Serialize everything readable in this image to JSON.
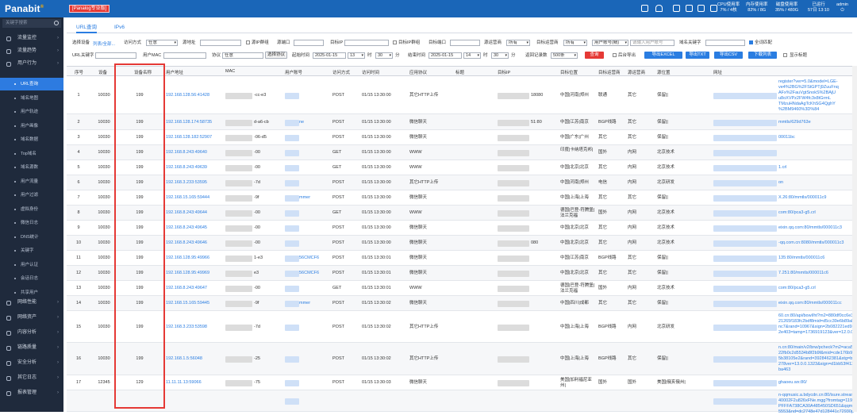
{
  "topbar": {
    "logo_text": "Panabit",
    "logo_mark": "®",
    "edition_badge": "[Panalog专业版]",
    "icons": [
      "grid-icon",
      "bell-icon",
      "download-icon",
      "desktop-icon",
      "print-icon",
      "monitor-icon",
      "layout-icon"
    ],
    "stats": [
      {
        "label": "CPU使用率",
        "value": "7% / 4核"
      },
      {
        "label": "内存使用率",
        "value": "82% / 8G"
      },
      {
        "label": "磁盘使用率",
        "value": "35% / 480G"
      },
      {
        "label": "已运行",
        "value": "57日 13:10"
      },
      {
        "label": "admin",
        "value": "⏻"
      }
    ]
  },
  "sidebar": {
    "search_placeholder": "关键字搜索",
    "groups_top": [
      {
        "label": "流量监控",
        "icon": "gauge-icon"
      },
      {
        "label": "流量趋势",
        "icon": "trend-icon"
      },
      {
        "label": "用户行为",
        "icon": "user-icon"
      }
    ],
    "items": [
      "URL查询",
      "域名地图",
      "用户轨迹",
      "用户画像",
      "域名数据",
      "Top域名",
      "域名源数",
      "用户流量",
      "用户过滤",
      "虚拟身份",
      "微信日志",
      "DNS统计",
      "关键字",
      "用户认证",
      "会话日志",
      "共享用户"
    ],
    "active_item": "URL查询",
    "groups_bottom": [
      {
        "label": "网络性能",
        "icon": "wifi-icon"
      },
      {
        "label": "网络资产",
        "icon": "globe-icon"
      },
      {
        "label": "内容分析",
        "icon": "layers-icon"
      },
      {
        "label": "链路质量",
        "icon": "link-icon"
      },
      {
        "label": "安全分析",
        "icon": "shield-icon"
      },
      {
        "label": "其它日志",
        "icon": "file-icon"
      },
      {
        "label": "报表管理",
        "icon": "report-icon"
      }
    ]
  },
  "tabs": [
    {
      "label": "URL查询",
      "active": true
    },
    {
      "label": "IPv6",
      "active": false
    }
  ],
  "filters": {
    "row1": {
      "select_device_label": "选择设备",
      "device_list_link": "列表/全部...",
      "access_method_label": "访问方式",
      "access_method_value": "任意",
      "src_addr_label": "源地址",
      "exclude_ip_group_label": "源IP群组",
      "src_port_label": "源端口",
      "dst_ip_label": "目标IP",
      "dst_ip_group_label": "目标IP群组",
      "dst_port_label": "目标端口",
      "src_operator_label": "源运营商",
      "src_operator_value": "所有",
      "dst_operator_label": "目标运营商",
      "dst_operator_value": "所有",
      "user_account_select": "用户账号(精)",
      "user_account_placeholder": "请输入用户账号",
      "domain_keyword_label": "域名关键字",
      "exact_match_label": "全词匹配"
    },
    "row2": {
      "url_keyword_label": "URL关键字",
      "user_mac_label": "用户MAC",
      "protocol_label": "协议",
      "protocol_value": "任意",
      "choose_protocol_btn": "选择协议",
      "start_time_label": "起始时间",
      "start_date": "2025-01-15",
      "start_hour": "13",
      "start_hour_unit": "时",
      "start_min": "30",
      "start_min_unit": "分",
      "end_time_label": "结束时间",
      "end_date": "2025-01-15",
      "end_hour": "14",
      "end_hour_unit": "时",
      "end_min": "30",
      "end_min_unit": "分",
      "return_count_label": "返回记录数",
      "return_count_value": "500条",
      "query_btn": "查询",
      "background_export_label": "后台导出",
      "export_excel_btn": "导出EXCEL",
      "export_txt_btn": "导出TXT",
      "export_csv_btn": "导出CSV",
      "download_list_btn": "下载列表",
      "show_title_label": "显示标题"
    }
  },
  "table": {
    "headers": [
      "序号",
      "设备",
      "设备名称",
      "用户地址",
      "MAC",
      "用户账号",
      "访问方式",
      "访问时间",
      "应用协议",
      "标题",
      "目标IP",
      "目标位置",
      "目标运营商",
      "源运营商",
      "源位置",
      "网址"
    ],
    "rows": [
      {
        "seq": "1",
        "dev": "10030",
        "name": "199",
        "addr": "192.168.128.56:41428",
        "mac": "-cc-e3",
        "acct": "",
        "method": "POST",
        "time": "01/15 13:30:00",
        "app": "其它HTTP上传",
        "dst_ip": "18080",
        "dst_loc": "中国|河南|郑州",
        "dst_op": "联通",
        "src_op": "其它",
        "src_loc": "保留||",
        "url": "register?ver=5.0&model=LGE-\nve4%2BG%2FStGPTj9ZuuFnq\nAFx%2FauVgtSnokS%2BAjU\nu8oXVPz2FW4fc3x8tGrmL\nTMzuHNdaAgTcKhSG4QghY\n%2BM9460%3D%84"
      },
      {
        "seq": "2",
        "dev": "10030",
        "name": "199",
        "addr": "192.168.128.174:58735",
        "mac": "d-a6-cb",
        "acct": "ne",
        "method": "POST",
        "time": "01/15 13:30:00",
        "app": "微信聊天",
        "dst_ip": "51:80",
        "dst_loc": "中国|江苏|南京",
        "dst_op": "BGP线路",
        "src_op": "其它",
        "src_loc": "保留||",
        "url": "mmtls/629d763e"
      },
      {
        "seq": "3",
        "dev": "10030",
        "name": "199",
        "addr": "192.168.128.182:52907",
        "mac": "-06-d5",
        "acct": "",
        "method": "POST",
        "time": "01/15 13:30:00",
        "app": "微信聊天",
        "dst_ip": "",
        "dst_loc": "中国|广东|广州",
        "dst_op": "其它",
        "src_op": "其它",
        "src_loc": "保留||",
        "url": "00011bc"
      },
      {
        "seq": "4",
        "dev": "10030",
        "name": "199",
        "addr": "192.168.8.243:49640",
        "mac": "-00",
        "acct": "",
        "method": "GET",
        "time": "01/15 13:30:00",
        "app": "WWW",
        "dst_ip": "",
        "dst_loc": "印度|卡纳塔克邦|",
        "dst_op": "国外",
        "src_op": "内网",
        "src_loc": "北京技术",
        "url": ""
      },
      {
        "seq": "5",
        "dev": "10030",
        "name": "199",
        "addr": "192.168.8.243:49639",
        "mac": "-00",
        "acct": "",
        "method": "GET",
        "time": "01/15 13:30:00",
        "app": "WWW",
        "dst_ip": "",
        "dst_loc": "中国|北京|北京",
        "dst_op": "其它",
        "src_op": "内网",
        "src_loc": "北京技术",
        "url": "1.crl"
      },
      {
        "seq": "6",
        "dev": "10030",
        "name": "199",
        "addr": "192.168.3.233:53595",
        "mac": "-7d",
        "acct": "",
        "method": "POST",
        "time": "01/15 13:30:00",
        "app": "其它HTTP上传",
        "dst_ip": "",
        "dst_loc": "中国|河南|郑州",
        "dst_op": "电信",
        "src_op": "内网",
        "src_loc": "北京研发",
        "url": "on"
      },
      {
        "seq": "7",
        "dev": "10030",
        "name": "199",
        "addr": "192.168.15.165:59444",
        "mac": "-9f",
        "acct": "mmer",
        "method": "POST",
        "time": "01/15 13:30:00",
        "app": "微信聊天",
        "dst_ip": "",
        "dst_loc": "中国|上海|上海",
        "dst_op": "其它",
        "src_op": "其它",
        "src_loc": "保留||",
        "url": "X.26:80/mmtls/000011c9"
      },
      {
        "seq": "8",
        "dev": "10030",
        "name": "199",
        "addr": "192.168.8.243:49644",
        "mac": "-00",
        "acct": "",
        "method": "GET",
        "time": "01/15 13:30:00",
        "app": "WWW",
        "dst_ip": "",
        "dst_loc": "德国|巴登-符腾堡|法兰克福",
        "dst_op": "国外",
        "src_op": "内网",
        "src_loc": "北京技术",
        "url": "com:80/pca3-g5.crl"
      },
      {
        "seq": "9",
        "dev": "10030",
        "name": "199",
        "addr": "192.168.8.243:49645",
        "mac": "-00",
        "acct": "",
        "method": "POST",
        "time": "01/15 13:30:00",
        "app": "微信聊天",
        "dst_ip": "",
        "dst_loc": "中国|北京|北京",
        "dst_op": "其它",
        "src_op": "内网",
        "src_loc": "北京技术",
        "url": "eixin.qq.com:80/mmtls/000011c3"
      },
      {
        "seq": "10",
        "dev": "10030",
        "name": "199",
        "addr": "192.168.8.243:49646",
        "mac": "-00",
        "acct": "",
        "method": "POST",
        "time": "01/15 13:30:00",
        "app": "微信聊天",
        "dst_ip": "080",
        "dst_loc": "中国|北京|北京",
        "dst_op": "其它",
        "src_op": "内网",
        "src_loc": "北京技术",
        "url": "-qq.com.cn:8080/mmtls/000011c3"
      },
      {
        "seq": "11",
        "dev": "10030",
        "name": "199",
        "addr": "192.168.128.95:49966",
        "mac": "1-e3",
        "acct": "56CMCF6",
        "method": "POST",
        "time": "01/15 13:30:01",
        "app": "微信聊天",
        "dst_ip": "",
        "dst_loc": "中国|江苏|南京",
        "dst_op": "BGP线路",
        "src_op": "其它",
        "src_loc": "保留||",
        "url": "135:80/mmtls/000011c6"
      },
      {
        "seq": "12",
        "dev": "10030",
        "name": "199",
        "addr": "192.168.128.95:49969",
        "mac": "e3",
        "acct": "56CMCF6",
        "method": "POST",
        "time": "01/15 13:30:01",
        "app": "微信聊天",
        "dst_ip": "",
        "dst_loc": "中国|北京|北京",
        "dst_op": "其它",
        "src_op": "其它",
        "src_loc": "保留||",
        "url": "7.251:80/mmtls/000011c6"
      },
      {
        "seq": "13",
        "dev": "10030",
        "name": "199",
        "addr": "192.168.8.243:49647",
        "mac": "-00",
        "acct": "",
        "method": "GET",
        "time": "01/15 13:30:01",
        "app": "WWW",
        "dst_ip": "",
        "dst_loc": "德国|巴登-符腾堡|法兰克福",
        "dst_op": "国外",
        "src_op": "内网",
        "src_loc": "北京技术",
        "url": "com:80/pca3-g5.crl"
      },
      {
        "seq": "14",
        "dev": "10030",
        "name": "199",
        "addr": "192.168.15.165:59445",
        "mac": "-9f",
        "acct": "mmer",
        "method": "POST",
        "time": "01/15 13:30:02",
        "app": "微信聊天",
        "dst_ip": "",
        "dst_loc": "中国|四川|成都",
        "dst_op": "其它",
        "src_op": "其它",
        "src_loc": "保留||",
        "url": "eixin.qq.com:80/mmtls/000011cc"
      },
      {
        "seq": "15",
        "dev": "10030",
        "name": "199",
        "addr": "192.168.3.233:53598",
        "mac": "-7d",
        "acct": "",
        "method": "POST",
        "time": "01/15 13:30:02",
        "app": "其它HTTP上传",
        "dst_ip": "",
        "dst_loc": "中国|上海|上海",
        "dst_op": "BGP线路",
        "src_op": "内网",
        "src_loc": "北京研发",
        "url": "60.cn:80/api/bowl/ht?m2=880df0cc6e30\n21265f183fc2bdf8mid=d5cc39e6b89ab\nnc7&rand=10967&sign=2b082221ed92\n2e403=tamp=1736919123&ver=12.0.0.1"
      },
      {
        "seq": "16",
        "dev": "10030",
        "name": "199",
        "addr": "192.168.1.5:56048",
        "mac": "-25",
        "acct": "",
        "method": "POST",
        "time": "01/15 13:30:02",
        "app": "其它HTTP上传",
        "dst_ip": "",
        "dst_loc": "中国|上海|上海",
        "dst_op": "BGP线路",
        "src_op": "其它",
        "src_loc": "保留||",
        "url": "n.cn:80/main/v2/brw/pcheck?m2=aca53af\n22fb0c2d5534b8f2b9f&mid=cde176b9\n5b38105e2&rand=3928462381&stg=brw\n278ver=13.0.0.1323&sign=d1bb53f413fe\nba463"
      },
      {
        "seq": "17",
        "dev": "12345",
        "name": "129",
        "addr": "11.11.11.13:59066",
        "mac": "-75",
        "acct": "",
        "method": "POST",
        "time": "01/15 13:30:03",
        "app": "微信聊天",
        "dst_ip": "",
        "dst_loc": "美国|加利福尼亚州|",
        "dst_op": "国外",
        "src_op": "国外",
        "src_loc": "美国|俄亥俄州|",
        "url": "ghaoeu.wx:80/"
      },
      {
        "seq": "",
        "dev": "",
        "name": "",
        "addr": "",
        "mac": "",
        "acct": "",
        "method": "",
        "time": "",
        "app": "",
        "dst_ip": "",
        "dst_loc": "",
        "dst_op": "",
        "src_op": "",
        "src_loc": "",
        "url": "n-qqmusic.a.bdycdn.cn:80/isure.stream.q\n40002F2u826xFNe.mgg?fromtag=11979\nPFFFA738CA30A485450SD651&qqm_type\n5553&nd=dc2748e47d128441c72930pcode=1p"
      }
    ]
  }
}
